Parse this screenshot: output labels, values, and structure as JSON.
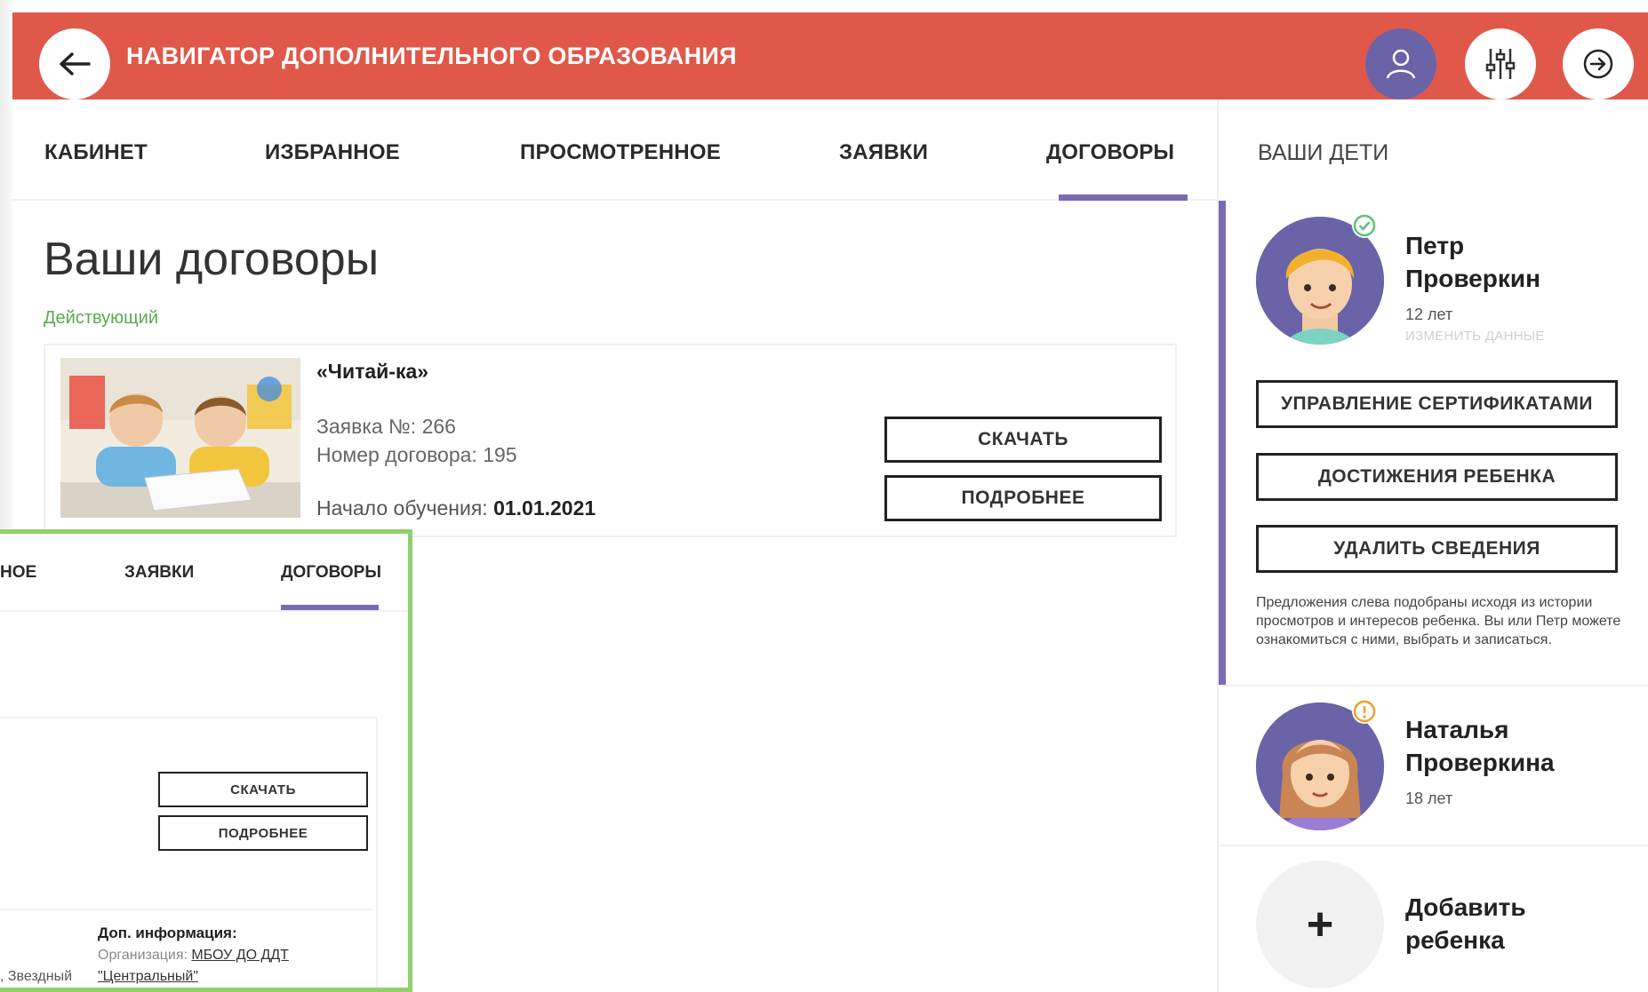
{
  "header": {
    "title": "НАВИГАТОР ДОПОЛНИТЕЛЬНОГО ОБРАЗОВАНИЯ",
    "accent_color": "#e0584a",
    "user_color": "#6a63a8",
    "icons": [
      "arrow-left-icon",
      "user-icon",
      "filter-sliders-icon",
      "logout-arrow-icon"
    ]
  },
  "tabs": {
    "cabinet": "КАБИНЕТ",
    "favorites": "ИЗБРАННОЕ",
    "viewed": "ПРОСМОТРЕННОЕ",
    "requests": "ЗАЯВКИ",
    "contracts": "ДОГОВОРЫ",
    "active": "contracts",
    "underline_color": "#7a6ab3"
  },
  "right_header": {
    "label": "ВАШИ ДЕТИ"
  },
  "main": {
    "title": "Ваши договоры",
    "status": "Действующий",
    "status_color": "#5aa84d",
    "contract": {
      "name": "«Читай-ка»",
      "request_label": "Заявка №:",
      "request_no": "266",
      "contract_label": "Номер договора:",
      "contract_no": "195",
      "start_label": "Начало обучения:",
      "start_date": "01.01.2021",
      "download": "СКАЧАТЬ",
      "details": "ПОДРОБНЕЕ"
    }
  },
  "zoom": {
    "tab_partial": "НОЕ",
    "tab_requests": "ЗАЯВКИ",
    "tab_contracts": "ДОГОВОРЫ",
    "download": "СКАЧАТЬ",
    "details": "ПОДРОБНЕЕ",
    "info_title": "Доп. информация:",
    "org_label": "Организация:",
    "org_value_1": "МБОУ ДО ДДТ",
    "org_value_2": "\"Центральный\"",
    "left_fragment": ", Звездный",
    "border_color": "#8fd06a"
  },
  "children": [
    {
      "name_line1": "Петр",
      "name_line2": "Проверкин",
      "age": "12 лет",
      "edit": "ИЗМЕНИТЬ ДАННЫЕ",
      "badge": "check",
      "buttons": {
        "certificates": "УПРАВЛЕНИЕ СЕРТИФИКАТАМИ",
        "achievements": "ДОСТИЖЕНИЯ РЕБЕНКА",
        "delete": "УДАЛИТЬ СВЕДЕНИЯ"
      },
      "note": "Предложения слева подобраны исходя из истории просмотров и интересов ребенка. Вы или Петр можете ознакомиться с ними, выбрать и записаться."
    },
    {
      "name_line1": "Наталья",
      "name_line2": "Проверкина",
      "age": "18 лет",
      "badge": "warning"
    }
  ],
  "add_child": {
    "line1": "Добавить",
    "line2": "ребенка",
    "symbol": "+"
  }
}
